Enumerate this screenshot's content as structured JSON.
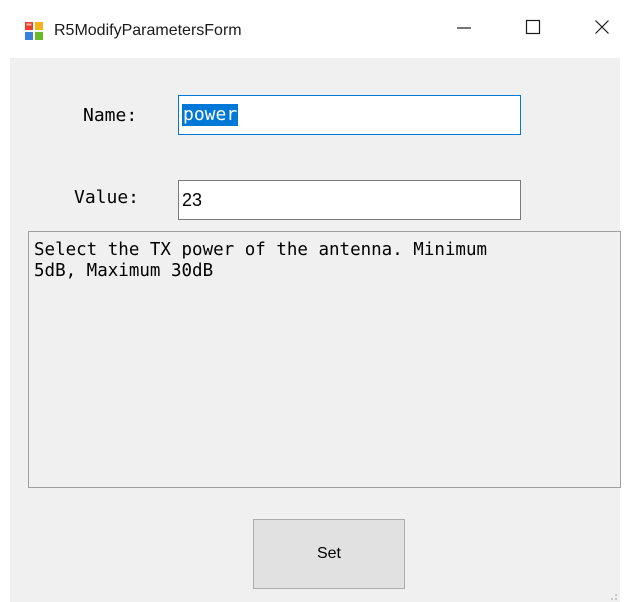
{
  "window": {
    "title": "R5ModifyParametersForm",
    "app_icon": "winforms-app-icon",
    "controls": {
      "minimize_icon": "minimize-icon",
      "maximize_icon": "maximize-icon",
      "close_icon": "close-icon"
    }
  },
  "form": {
    "name_label": "Name:",
    "name_value": "power",
    "value_label": "Value:",
    "value_value": "23",
    "description": "Select the TX power of the antenna. Minimum\n5dB, Maximum 30dB",
    "set_button_label": "Set"
  },
  "colors": {
    "client_bg": "#f0f0f0",
    "focus_border": "#0078d7",
    "selection_bg": "#0078d7",
    "button_bg": "#e1e1e1"
  }
}
